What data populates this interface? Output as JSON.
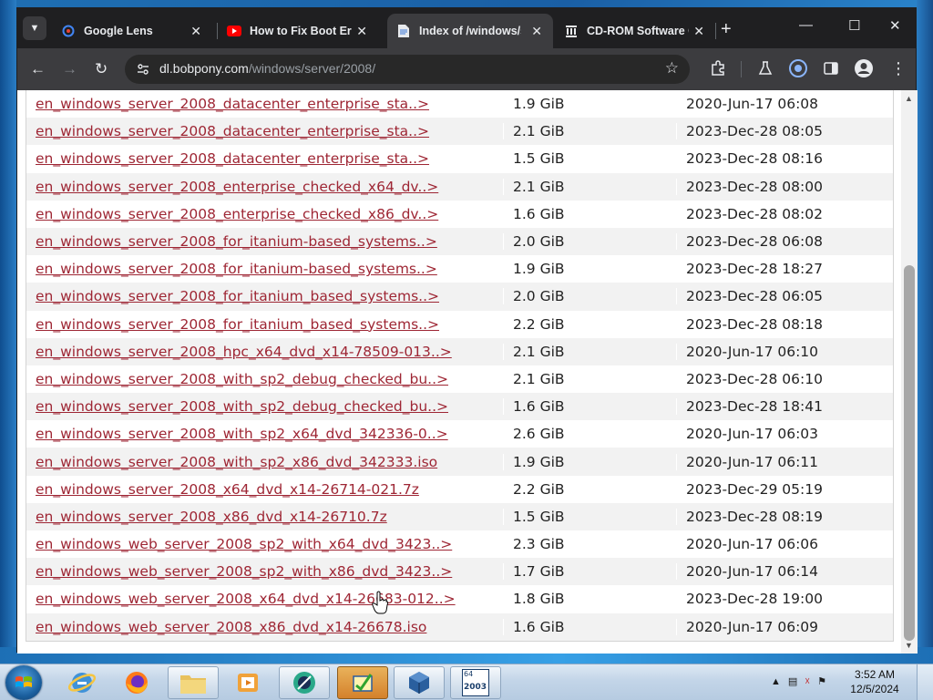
{
  "browser": {
    "tabs": [
      {
        "title": "Google Lens",
        "icon": "google-lens-icon",
        "active": false
      },
      {
        "title": "How to Fix Boot Erro",
        "icon": "youtube-icon",
        "active": false
      },
      {
        "title": "Index of /windows/s",
        "icon": "page-icon",
        "active": true
      },
      {
        "title": "CD-ROM Software C",
        "icon": "archive-org-icon",
        "active": false
      }
    ],
    "url_host": "dl.bobpony.com",
    "url_path": "/windows/server/2008/"
  },
  "listing": {
    "rows": [
      {
        "name": "en_windows_server_2008_datacenter_enterprise_sta..>",
        "size": "1.9 GiB",
        "date": "2020-Jun-17 06:08"
      },
      {
        "name": "en_windows_server_2008_datacenter_enterprise_sta..>",
        "size": "2.1 GiB",
        "date": "2023-Dec-28 08:05"
      },
      {
        "name": "en_windows_server_2008_datacenter_enterprise_sta..>",
        "size": "1.5 GiB",
        "date": "2023-Dec-28 08:16"
      },
      {
        "name": "en_windows_server_2008_enterprise_checked_x64_dv..>",
        "size": "2.1 GiB",
        "date": "2023-Dec-28 08:00"
      },
      {
        "name": "en_windows_server_2008_enterprise_checked_x86_dv..>",
        "size": "1.6 GiB",
        "date": "2023-Dec-28 08:02"
      },
      {
        "name": "en_windows_server_2008_for_itanium-based_systems..>",
        "size": "2.0 GiB",
        "date": "2023-Dec-28 06:08"
      },
      {
        "name": "en_windows_server_2008_for_itanium-based_systems..>",
        "size": "1.9 GiB",
        "date": "2023-Dec-28 18:27"
      },
      {
        "name": "en_windows_server_2008_for_itanium_based_systems..>",
        "size": "2.0 GiB",
        "date": "2023-Dec-28 06:05"
      },
      {
        "name": "en_windows_server_2008_for_itanium_based_systems..>",
        "size": "2.2 GiB",
        "date": "2023-Dec-28 08:18"
      },
      {
        "name": "en_windows_server_2008_hpc_x64_dvd_x14-78509-013..>",
        "size": "2.1 GiB",
        "date": "2020-Jun-17 06:10"
      },
      {
        "name": "en_windows_server_2008_with_sp2_debug_checked_bu..>",
        "size": "2.1 GiB",
        "date": "2023-Dec-28 06:10"
      },
      {
        "name": "en_windows_server_2008_with_sp2_debug_checked_bu..>",
        "size": "1.6 GiB",
        "date": "2023-Dec-28 18:41"
      },
      {
        "name": "en_windows_server_2008_with_sp2_x64_dvd_342336-0..>",
        "size": "2.6 GiB",
        "date": "2020-Jun-17 06:03"
      },
      {
        "name": "en_windows_server_2008_with_sp2_x86_dvd_342333.iso",
        "size": "1.9 GiB",
        "date": "2020-Jun-17 06:11"
      },
      {
        "name": "en_windows_server_2008_x64_dvd_x14-26714-021.7z",
        "size": "2.2 GiB",
        "date": "2023-Dec-29 05:19"
      },
      {
        "name": "en_windows_server_2008_x86_dvd_x14-26710.7z",
        "size": "1.5 GiB",
        "date": "2023-Dec-28 08:19"
      },
      {
        "name": "en_windows_web_server_2008_sp2_with_x64_dvd_3423..>",
        "size": "2.3 GiB",
        "date": "2020-Jun-17 06:06"
      },
      {
        "name": "en_windows_web_server_2008_sp2_with_x86_dvd_3423..>",
        "size": "1.7 GiB",
        "date": "2020-Jun-17 06:14"
      },
      {
        "name": "en_windows_web_server_2008_x64_dvd_x14-26683-012..>",
        "size": "1.8 GiB",
        "date": "2023-Dec-28 19:00"
      },
      {
        "name": "en_windows_web_server_2008_x86_dvd_x14-26678.iso",
        "size": "1.6 GiB",
        "date": "2020-Jun-17 06:09"
      }
    ]
  },
  "taskbar": {
    "apps": [
      "internet-explorer-icon",
      "firefox-icon",
      "explorer-icon",
      "media-player-icon",
      "app-icon",
      "installer-icon",
      "virtualbox-icon",
      "win2003-icon"
    ],
    "badge_text": "2003",
    "badge_top": "64"
  },
  "clock": {
    "time": "3:52 AM",
    "date": "12/5/2024"
  },
  "colors": {
    "link": "#9e2634",
    "tabbar": "#1f1f21",
    "toolbar": "#3c3c3f"
  }
}
